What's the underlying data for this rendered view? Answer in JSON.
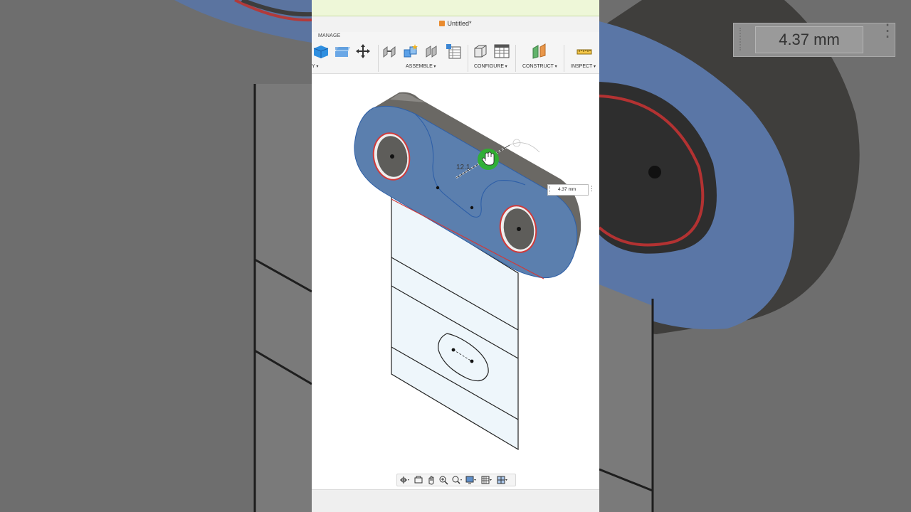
{
  "app": {
    "document_title": "Untitled*",
    "tab_label": "MANAGE"
  },
  "toolbar": {
    "groups": [
      {
        "label": "Y"
      },
      {
        "label": "ASSEMBLE"
      },
      {
        "label": "CONFIGURE"
      },
      {
        "label": "CONSTRUCT"
      },
      {
        "label": "INSPECT"
      }
    ]
  },
  "canvas": {
    "sketch_dimension_partial": "12.1",
    "dimension_input_value": "4.37 mm"
  },
  "zoomed_overlay": {
    "dimension_input_value": "4.37 mm"
  },
  "colors": {
    "face_selection": "#5b7fae",
    "body_gray": "#6a6864",
    "edge_red": "#d03a3a",
    "sketch_plane": "#eef6fb",
    "cursor_green": "#2bb52b",
    "title_cube": "#e98b2f"
  },
  "icons": [
    "new-component-icon",
    "extrude-box-icon",
    "move-icon",
    "joint-icon",
    "as-built-joint-icon",
    "rigid-group-icon",
    "table-icon",
    "configure-icon",
    "configure-table-icon",
    "construct-plane-icon",
    "measure-icon",
    "orbit-icon",
    "look-at-icon",
    "pan-icon",
    "zoom-icon",
    "zoom-window-icon",
    "display-settings-icon",
    "grid-icon",
    "viewports-icon"
  ]
}
